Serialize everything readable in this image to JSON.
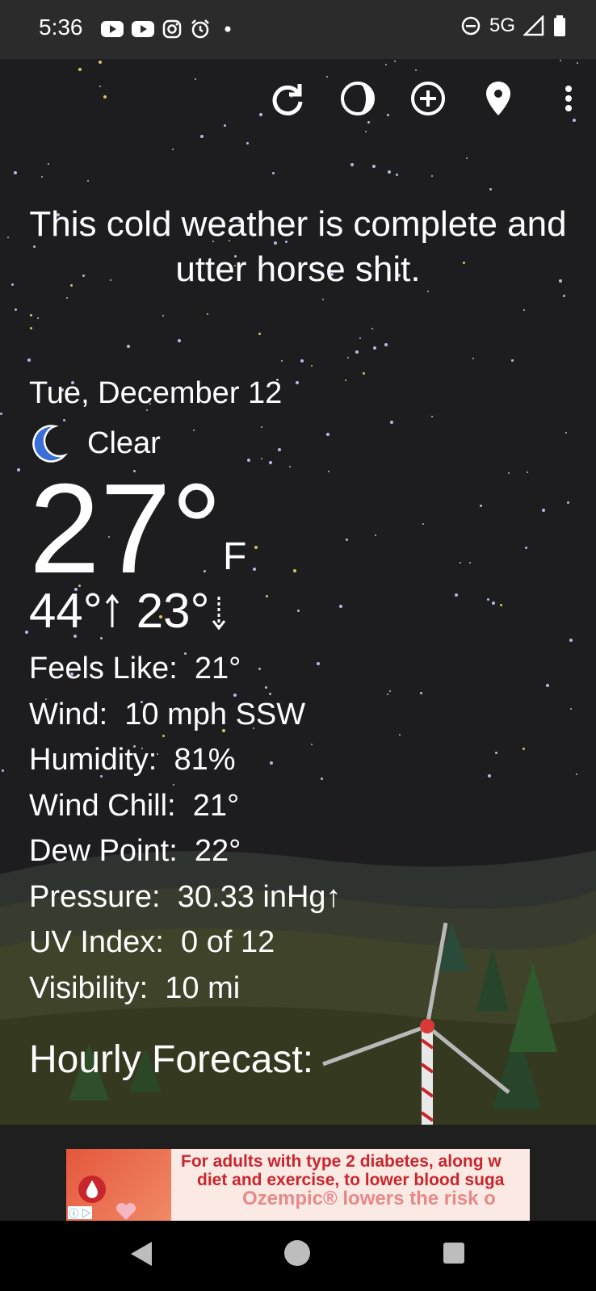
{
  "status_bar": {
    "time": "5:36",
    "network": "5G",
    "left_icons": [
      "youtube-icon",
      "youtube-icon",
      "instagram-icon",
      "alarm-icon",
      "dot-icon"
    ],
    "right_icons": [
      "do-not-disturb-icon",
      "signal-icon",
      "battery-icon"
    ]
  },
  "toolbar": {
    "icons": [
      "refresh-icon",
      "moon-phase-icon",
      "add-location-icon",
      "location-pin-icon",
      "more-vert-icon"
    ]
  },
  "weather": {
    "quote": "This cold weather is complete and utter horse shit.",
    "date": "Tue, December 12",
    "condition": "Clear",
    "temperature": "27°",
    "unit": "F",
    "high": "44°",
    "low": "23°",
    "details": [
      {
        "label": "Feels Like:",
        "value": "21°"
      },
      {
        "label": "Wind:",
        "value": "10 mph SSW"
      },
      {
        "label": "Humidity:",
        "value": "81%"
      },
      {
        "label": "Wind Chill:",
        "value": "21°"
      },
      {
        "label": "Dew Point:",
        "value": "22°"
      },
      {
        "label": "Pressure:",
        "value": "30.33 inHg↑"
      },
      {
        "label": "UV Index:",
        "value": "0 of 12"
      },
      {
        "label": "Visibility:",
        "value": "10 mi"
      }
    ],
    "hourly_heading": "Hourly Forecast:"
  },
  "ad": {
    "line1": "For adults with type 2 diabetes, along w",
    "line2": "diet and exercise, to lower blood suga",
    "line3": "Ozempic® lowers the risk o"
  },
  "colors": {
    "accent_moon": "#3b6fd8",
    "ad_red": "#c8262d"
  }
}
